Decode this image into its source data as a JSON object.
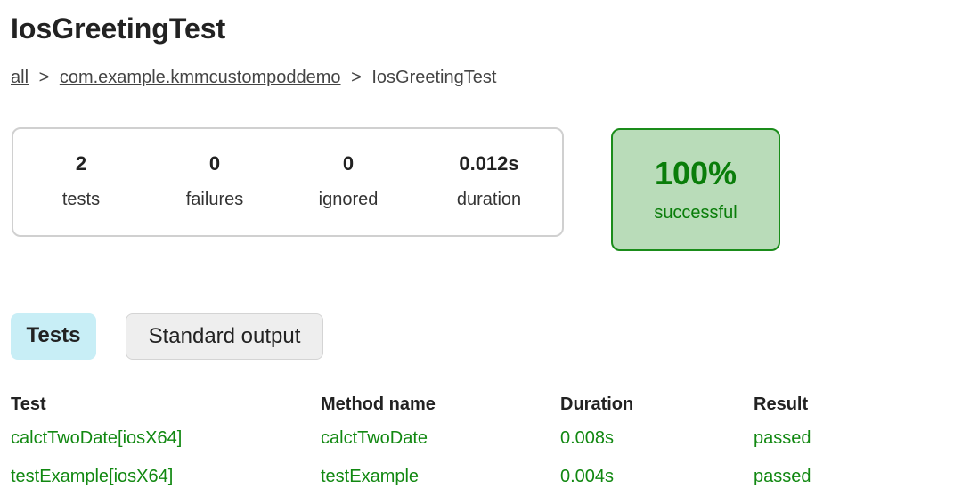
{
  "page": {
    "title": "IosGreetingTest"
  },
  "breadcrumb": {
    "items": [
      {
        "label": "all"
      },
      {
        "label": "com.example.kmmcustompoddemo"
      },
      {
        "label": "IosGreetingTest"
      }
    ],
    "separator": ">"
  },
  "summary": {
    "tests": {
      "value": "2",
      "label": "tests"
    },
    "failures": {
      "value": "0",
      "label": "failures"
    },
    "ignored": {
      "value": "0",
      "label": "ignored"
    },
    "duration": {
      "value": "0.012s",
      "label": "duration"
    }
  },
  "success": {
    "percent": "100%",
    "label": "successful",
    "color": "#0a7d0a",
    "background": "#b9dcb9"
  },
  "tabs": [
    {
      "label": "Tests",
      "selected": true
    },
    {
      "label": "Standard output",
      "selected": false
    }
  ],
  "table": {
    "headers": [
      "Test",
      "Method name",
      "Duration",
      "Result"
    ],
    "rows": [
      {
        "test": "calctTwoDate[iosX64]",
        "method": "calctTwoDate",
        "duration": "0.008s",
        "result": "passed"
      },
      {
        "test": "testExample[iosX64]",
        "method": "testExample",
        "duration": "0.004s",
        "result": "passed"
      }
    ],
    "pass_color": "#118811"
  }
}
